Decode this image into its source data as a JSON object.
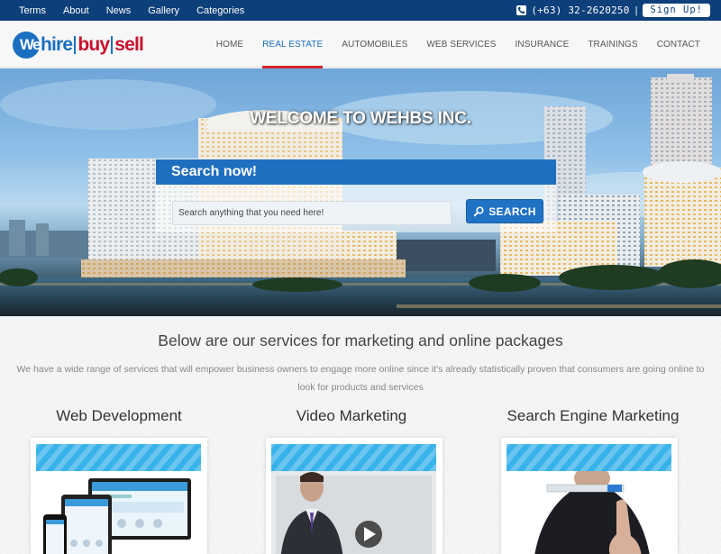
{
  "topbar": {
    "links": [
      "Terms",
      "About",
      "News",
      "Gallery",
      "Categories"
    ],
    "phone": "(+63) 32-2620250",
    "separator": "|",
    "signup_label": "Sign Up!",
    "icons": {
      "phone": "phone-icon"
    }
  },
  "logo": {
    "we": "We",
    "hire": "hire",
    "buy": "buy",
    "sell": "sell"
  },
  "nav": {
    "items": [
      "HOME",
      "REAL ESTATE",
      "AUTOMOBILES",
      "WEB SERVICES",
      "INSURANCE",
      "TRAININGS",
      "CONTACT"
    ],
    "active": "REAL ESTATE"
  },
  "hero": {
    "title": "WELCOME TO WEHBS INC.",
    "search_title": "Search now!",
    "search_placeholder": "Search anything that you need here!",
    "search_button": "SEARCH"
  },
  "services": {
    "title": "Below are our services for marketing and online packages",
    "description": "We have a wide range of services that will empower business owners to engage more online since it's already statistically proven that consumers are going online to look for products and services",
    "columns": [
      "Web Development",
      "Video Marketing",
      "Search Engine Marketing"
    ]
  },
  "colors": {
    "topbar": "#0d3f7a",
    "accent": "#1f6fc0",
    "active_underline": "#d4252d",
    "logo_red": "#c8102e",
    "card_stripe": "#38b2ea"
  }
}
